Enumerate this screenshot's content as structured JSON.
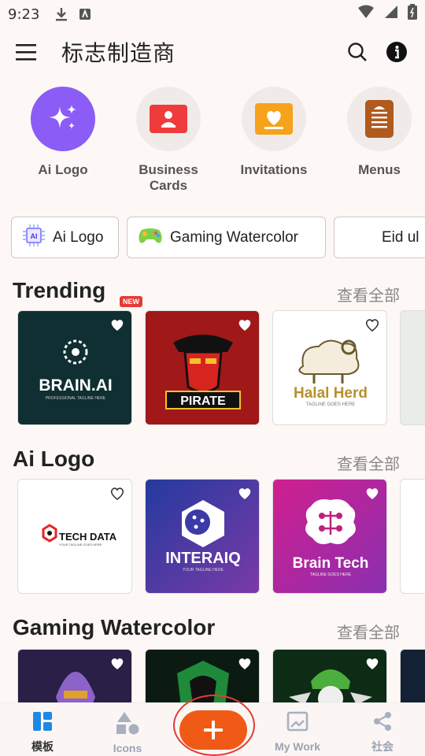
{
  "status": {
    "time": "9:23"
  },
  "appbar": {
    "title": "标志制造商"
  },
  "categories": [
    {
      "label": "Ai Logo",
      "icon": "sparkles-icon"
    },
    {
      "label": "Business\nCards",
      "icon": "business-card-icon"
    },
    {
      "label": "Invitations",
      "icon": "invitation-heart-icon"
    },
    {
      "label": "Menus",
      "icon": "menu-list-icon"
    }
  ],
  "chips": [
    {
      "label": "Ai Logo",
      "icon": "ai-chip-icon"
    },
    {
      "label": "Gaming Watercolor",
      "icon": "gamepad-icon"
    },
    {
      "label": "Eid ul"
    }
  ],
  "sections": [
    {
      "title": "Trending",
      "see_all": "查看全部",
      "badge": "NEW",
      "cards": [
        {
          "name": "BRAIN.AI",
          "tagline": "PROFESSIONAL TAGLINE HERE"
        },
        {
          "name": "PIRATE"
        },
        {
          "name": "Halal Herd",
          "tagline": "TAGLINE GOES HERE"
        },
        {
          "name": ""
        }
      ]
    },
    {
      "title": "Ai Logo",
      "see_all": "查看全部",
      "cards": [
        {
          "name": "TECH DATA",
          "tagline": "YOUR TAGLINE GOES HERE"
        },
        {
          "name": "INTERAIQ",
          "tagline": "YOUR TAGLINE HERE"
        },
        {
          "name": "Brain Tech",
          "tagline": "TAGLINE GOES HERE"
        },
        {
          "name": ""
        }
      ]
    },
    {
      "title": "Gaming Watercolor",
      "see_all": "查看全部",
      "cards": [
        {
          "name": ""
        },
        {
          "name": ""
        },
        {
          "name": ""
        },
        {
          "name": ""
        }
      ]
    }
  ],
  "bottomnav": [
    {
      "label": "模板",
      "active": true
    },
    {
      "label": "Icons"
    },
    {
      "label": "My Work"
    },
    {
      "label": "社会"
    }
  ],
  "colors": {
    "accent": "#f05a16",
    "ring": "#e53935",
    "bg": "#fdf8f6"
  }
}
